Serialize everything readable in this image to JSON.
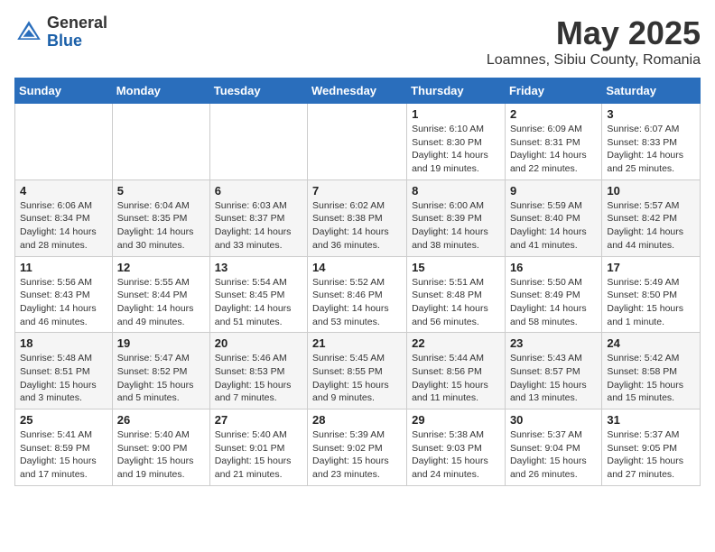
{
  "logo": {
    "general": "General",
    "blue": "Blue"
  },
  "title": {
    "month": "May 2025",
    "location": "Loamnes, Sibiu County, Romania"
  },
  "days_of_week": [
    "Sunday",
    "Monday",
    "Tuesday",
    "Wednesday",
    "Thursday",
    "Friday",
    "Saturday"
  ],
  "weeks": [
    [
      {
        "day": "",
        "info": ""
      },
      {
        "day": "",
        "info": ""
      },
      {
        "day": "",
        "info": ""
      },
      {
        "day": "",
        "info": ""
      },
      {
        "day": "1",
        "info": "Sunrise: 6:10 AM\nSunset: 8:30 PM\nDaylight: 14 hours and 19 minutes."
      },
      {
        "day": "2",
        "info": "Sunrise: 6:09 AM\nSunset: 8:31 PM\nDaylight: 14 hours and 22 minutes."
      },
      {
        "day": "3",
        "info": "Sunrise: 6:07 AM\nSunset: 8:33 PM\nDaylight: 14 hours and 25 minutes."
      }
    ],
    [
      {
        "day": "4",
        "info": "Sunrise: 6:06 AM\nSunset: 8:34 PM\nDaylight: 14 hours and 28 minutes."
      },
      {
        "day": "5",
        "info": "Sunrise: 6:04 AM\nSunset: 8:35 PM\nDaylight: 14 hours and 30 minutes."
      },
      {
        "day": "6",
        "info": "Sunrise: 6:03 AM\nSunset: 8:37 PM\nDaylight: 14 hours and 33 minutes."
      },
      {
        "day": "7",
        "info": "Sunrise: 6:02 AM\nSunset: 8:38 PM\nDaylight: 14 hours and 36 minutes."
      },
      {
        "day": "8",
        "info": "Sunrise: 6:00 AM\nSunset: 8:39 PM\nDaylight: 14 hours and 38 minutes."
      },
      {
        "day": "9",
        "info": "Sunrise: 5:59 AM\nSunset: 8:40 PM\nDaylight: 14 hours and 41 minutes."
      },
      {
        "day": "10",
        "info": "Sunrise: 5:57 AM\nSunset: 8:42 PM\nDaylight: 14 hours and 44 minutes."
      }
    ],
    [
      {
        "day": "11",
        "info": "Sunrise: 5:56 AM\nSunset: 8:43 PM\nDaylight: 14 hours and 46 minutes."
      },
      {
        "day": "12",
        "info": "Sunrise: 5:55 AM\nSunset: 8:44 PM\nDaylight: 14 hours and 49 minutes."
      },
      {
        "day": "13",
        "info": "Sunrise: 5:54 AM\nSunset: 8:45 PM\nDaylight: 14 hours and 51 minutes."
      },
      {
        "day": "14",
        "info": "Sunrise: 5:52 AM\nSunset: 8:46 PM\nDaylight: 14 hours and 53 minutes."
      },
      {
        "day": "15",
        "info": "Sunrise: 5:51 AM\nSunset: 8:48 PM\nDaylight: 14 hours and 56 minutes."
      },
      {
        "day": "16",
        "info": "Sunrise: 5:50 AM\nSunset: 8:49 PM\nDaylight: 14 hours and 58 minutes."
      },
      {
        "day": "17",
        "info": "Sunrise: 5:49 AM\nSunset: 8:50 PM\nDaylight: 15 hours and 1 minute."
      }
    ],
    [
      {
        "day": "18",
        "info": "Sunrise: 5:48 AM\nSunset: 8:51 PM\nDaylight: 15 hours and 3 minutes."
      },
      {
        "day": "19",
        "info": "Sunrise: 5:47 AM\nSunset: 8:52 PM\nDaylight: 15 hours and 5 minutes."
      },
      {
        "day": "20",
        "info": "Sunrise: 5:46 AM\nSunset: 8:53 PM\nDaylight: 15 hours and 7 minutes."
      },
      {
        "day": "21",
        "info": "Sunrise: 5:45 AM\nSunset: 8:55 PM\nDaylight: 15 hours and 9 minutes."
      },
      {
        "day": "22",
        "info": "Sunrise: 5:44 AM\nSunset: 8:56 PM\nDaylight: 15 hours and 11 minutes."
      },
      {
        "day": "23",
        "info": "Sunrise: 5:43 AM\nSunset: 8:57 PM\nDaylight: 15 hours and 13 minutes."
      },
      {
        "day": "24",
        "info": "Sunrise: 5:42 AM\nSunset: 8:58 PM\nDaylight: 15 hours and 15 minutes."
      }
    ],
    [
      {
        "day": "25",
        "info": "Sunrise: 5:41 AM\nSunset: 8:59 PM\nDaylight: 15 hours and 17 minutes."
      },
      {
        "day": "26",
        "info": "Sunrise: 5:40 AM\nSunset: 9:00 PM\nDaylight: 15 hours and 19 minutes."
      },
      {
        "day": "27",
        "info": "Sunrise: 5:40 AM\nSunset: 9:01 PM\nDaylight: 15 hours and 21 minutes."
      },
      {
        "day": "28",
        "info": "Sunrise: 5:39 AM\nSunset: 9:02 PM\nDaylight: 15 hours and 23 minutes."
      },
      {
        "day": "29",
        "info": "Sunrise: 5:38 AM\nSunset: 9:03 PM\nDaylight: 15 hours and 24 minutes."
      },
      {
        "day": "30",
        "info": "Sunrise: 5:37 AM\nSunset: 9:04 PM\nDaylight: 15 hours and 26 minutes."
      },
      {
        "day": "31",
        "info": "Sunrise: 5:37 AM\nSunset: 9:05 PM\nDaylight: 15 hours and 27 minutes."
      }
    ]
  ]
}
